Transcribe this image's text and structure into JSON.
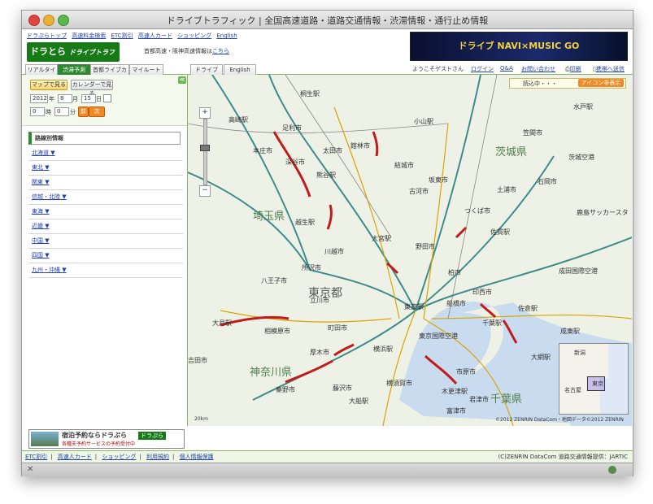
{
  "window": {
    "title": "ドライブトラフィック | 全国高速道路・道路交通情報・渋滞情報・通行止め情報"
  },
  "topnav": [
    "ドラぷらトップ",
    "高速料金検索",
    "ETC割引",
    "高速人カード",
    "ショッピング",
    "English"
  ],
  "logo": {
    "main": "ドラとら",
    "sub": "ドライブトラフィック"
  },
  "hwinfo": {
    "text": "首都高速・阪神高速情報は",
    "link": "こちら"
  },
  "banner": {
    "text": "ドライブ NAVI×MUSIC GO"
  },
  "tabs": [
    "リアルタイム",
    "渋滞予測",
    "首都ライブカメラ",
    "マイルート"
  ],
  "active_tab": "渋滞予測",
  "modes": [
    "ドライブ",
    "English"
  ],
  "user": {
    "greeting": "ようこそゲストさん",
    "login": "ログイン",
    "qa": "Q&A",
    "contact": "お問い合わせ",
    "print": "印刷",
    "mobile": "携帯へ送信"
  },
  "sidebar": {
    "map_view_button": "マップで見る",
    "calendar_button": "カレンダーで見る",
    "year": "2012",
    "year_label": "年",
    "month": "8",
    "month_label": "月",
    "day": "15",
    "day_label": "日",
    "hour": "0",
    "hour_label": "時",
    "minute": "0",
    "minute_label": "分",
    "next_button": "次",
    "prev_button": "前",
    "collapse": "≪",
    "route_header": "路線別情報",
    "regions": [
      "北海道 ▼",
      "東北 ▼",
      "関東 ▼",
      "信越・北陸 ▼",
      "東海 ▼",
      "近畿 ▼",
      "中国 ▼",
      "四国 ▼",
      "九州・沖縄 ▼"
    ]
  },
  "map": {
    "loading": "読込中・・・",
    "icon_toggle": "アイコン非表示",
    "prefectures": [
      "埼玉県",
      "東京都",
      "神奈川県",
      "茨城県",
      "千葉県"
    ],
    "stations": [
      "高崎駅",
      "桐生駅",
      "熊谷駅",
      "越生駅",
      "大宮駅",
      "東京駅",
      "大月駅",
      "横浜駅",
      "大船駅",
      "木更津駅",
      "千葉駅",
      "佐倉駅",
      "成東駅",
      "大網駅",
      "佐貫駅",
      "水戸駅",
      "小山駅",
      "鹿島サッカースタ"
    ],
    "places": [
      "東京国際空港",
      "成田国際空港",
      "茨城空港",
      "八王子市",
      "相模原市",
      "厚木市",
      "市原市",
      "つくば市",
      "古河市",
      "館林市",
      "足利市",
      "太田市",
      "深谷市",
      "本庄市",
      "川越市",
      "所沢市",
      "立川市",
      "町田市",
      "藤沢市",
      "横須賀市",
      "富津市",
      "君津市",
      "土浦市",
      "石岡市",
      "笠間市",
      "結城市",
      "坂東市",
      "野田市",
      "柏市",
      "印西市",
      "船橋市",
      "吉田市",
      "秦野市"
    ],
    "copyright": "©2012 ZENRIN DataCom・地図データ©2012 ZENRIN",
    "scale": "20km",
    "minimap": {
      "labels": [
        "新潟",
        "名古屋",
        "東京"
      ]
    }
  },
  "footer_ad": {
    "title": "宿泊予約ならドラぷら",
    "sub": "各種夫予約サービスの予約受付中",
    "tag": "ドラぷら"
  },
  "footer": {
    "links": [
      "ETC割引",
      "高速人カード",
      "ショッピング",
      "利用規約",
      "個人情報保護"
    ],
    "credit": "(C)ZENRIN DataCom   道路交通情報提供：JARTIC"
  }
}
